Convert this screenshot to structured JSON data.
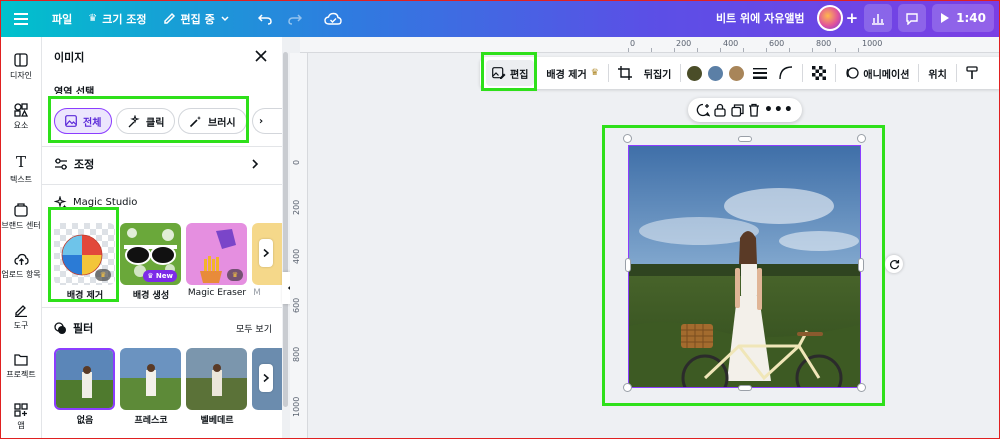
{
  "topbar": {
    "file": "파일",
    "resize": "크기 조정",
    "edit_mode": "편집 중",
    "project_title": "비트 위에 자유앨범",
    "present_time": "1:40"
  },
  "rail": {
    "items": [
      "디자인",
      "요소",
      "텍스트",
      "브랜드 센터",
      "업로드 항목",
      "도구",
      "프로젝트",
      "앱"
    ]
  },
  "panel": {
    "title": "이미지",
    "section_select": "영역 선택",
    "chips": [
      "전체",
      "클릭",
      "브러시"
    ],
    "adjust": "조정",
    "magic_studio": "Magic Studio",
    "magic_items": [
      {
        "label": "배경 제거"
      },
      {
        "label": "배경 생성",
        "badge": "New"
      },
      {
        "label": "Magic Eraser"
      },
      {
        "label": "M"
      }
    ],
    "filters_title": "필터",
    "see_all": "모두 보기",
    "filters": [
      "없음",
      "프레스코",
      "벨베데르"
    ]
  },
  "ruler": {
    "top": [
      "0",
      "200",
      "400",
      "600",
      "800",
      "1000"
    ],
    "left": [
      "0",
      "200",
      "400",
      "600",
      "800",
      "1000"
    ]
  },
  "toolbar": {
    "edit": "편집",
    "bg_remove": "배경 제거",
    "flip": "뒤집기",
    "animation": "애니메이션",
    "position": "위치",
    "swatches": [
      "#4a4d28",
      "#5b7fa6",
      "#a88559"
    ]
  },
  "colors": {
    "accent": "#8b3dff",
    "highlight": "#2ee01a"
  }
}
